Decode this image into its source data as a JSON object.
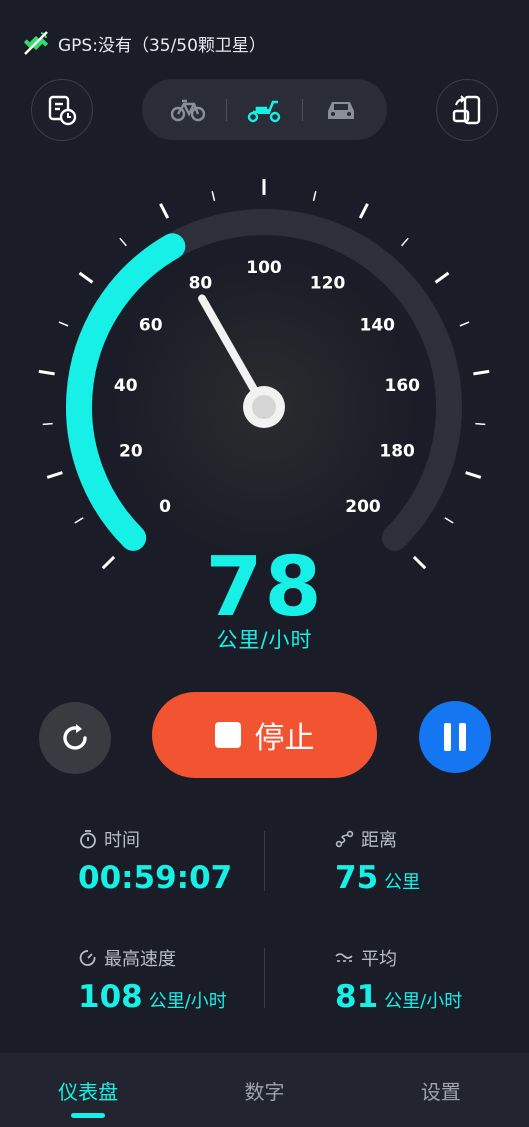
{
  "status": {
    "gps_text": "GPS:没有（35/50颗卫星）"
  },
  "header": {
    "left_button_icon": "record-history-icon",
    "right_button_icon": "screen-rotate-icon",
    "modes": [
      {
        "name": "bicycle",
        "icon": "bicycle-icon",
        "active": false
      },
      {
        "name": "scooter",
        "icon": "scooter-icon",
        "active": true
      },
      {
        "name": "car",
        "icon": "car-icon",
        "active": false
      }
    ]
  },
  "gauge": {
    "min": 0,
    "max": 200,
    "current": 78,
    "labels": [
      "0",
      "20",
      "40",
      "60",
      "80",
      "100",
      "120",
      "140",
      "160",
      "180",
      "200"
    ],
    "colors": {
      "active": "#16f0e6",
      "track": "#2d303a"
    }
  },
  "speed": {
    "value": "78",
    "unit": "公里/小时"
  },
  "controls": {
    "stop_label": "停止",
    "reset_icon": "reset-icon",
    "pause_icon": "pause-icon"
  },
  "stats": {
    "time": {
      "label": "时间",
      "value": "00:59:07"
    },
    "distance": {
      "label": "距离",
      "value": "75",
      "unit": "公里"
    },
    "max_speed": {
      "label": "最高速度",
      "value": "108",
      "unit": "公里/小时"
    },
    "average": {
      "label": "平均",
      "value": "81",
      "unit": "公里/小时"
    }
  },
  "tabs": [
    {
      "label": "仪表盘",
      "active": true
    },
    {
      "label": "数字",
      "active": false
    },
    {
      "label": "设置",
      "active": false
    }
  ],
  "colors": {
    "accent": "#16f0e6",
    "stop": "#f25330",
    "pause": "#1476f0",
    "background": "#1a1d27"
  }
}
